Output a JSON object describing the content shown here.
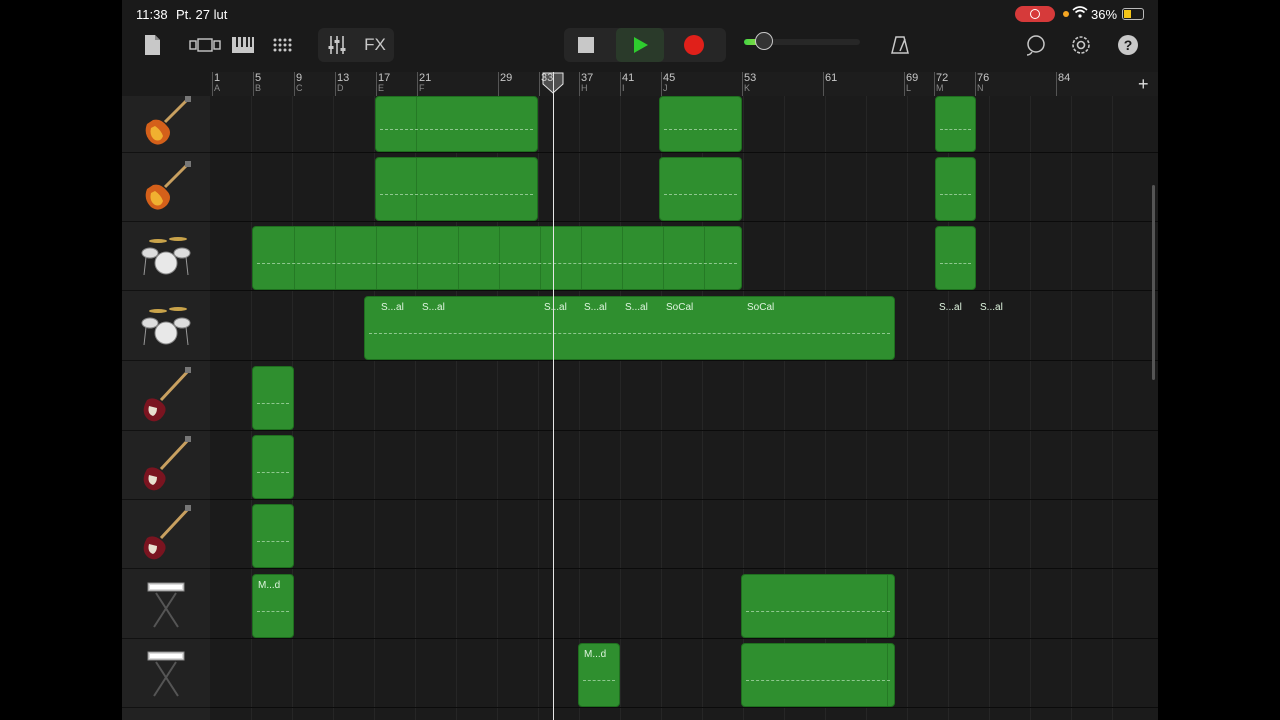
{
  "status": {
    "time": "11:38",
    "date": "Pt. 27 lut",
    "battery": "36%"
  },
  "toolbar": {
    "fx_label": "FX",
    "volume_level": 0.16,
    "icons": [
      "browser-icon",
      "view-toggle-icon",
      "keyboard-icon",
      "grid-icon",
      "mixer-icon",
      "fx",
      "stop-icon",
      "play-icon",
      "record-icon",
      "metronome-icon",
      "loop-icon",
      "settings-icon",
      "help-icon"
    ]
  },
  "ruler": {
    "bars": [
      {
        "num": "1",
        "sec": "A"
      },
      {
        "num": "5",
        "sec": "B"
      },
      {
        "num": "9",
        "sec": "C"
      },
      {
        "num": "13",
        "sec": "D"
      },
      {
        "num": "17",
        "sec": "E"
      },
      {
        "num": "21",
        "sec": "F"
      },
      {
        "num": "29",
        "sec": ""
      },
      {
        "num": "33",
        "sec": ""
      },
      {
        "num": "37",
        "sec": "H"
      },
      {
        "num": "41",
        "sec": "I"
      },
      {
        "num": "45",
        "sec": "J"
      },
      {
        "num": "53",
        "sec": "K"
      },
      {
        "num": "61",
        "sec": ""
      },
      {
        "num": "69",
        "sec": "L"
      },
      {
        "num": "72",
        "sec": "M"
      },
      {
        "num": "76",
        "sec": "N"
      },
      {
        "num": "84",
        "sec": ""
      }
    ]
  },
  "tracks": [
    {
      "instrument": "electric-guitar",
      "regions": []
    },
    {
      "instrument": "electric-guitar",
      "regions": []
    },
    {
      "instrument": "drum-kit",
      "regions": []
    },
    {
      "instrument": "drum-kit",
      "regions": [
        {
          "label": "S...al"
        },
        {
          "label": "S...al"
        },
        {
          "label": "S...al"
        },
        {
          "label": "S...al"
        },
        {
          "label": "S...al"
        },
        {
          "label": "SoCal"
        },
        {
          "label": "SoCal"
        },
        {
          "label": "S...al"
        },
        {
          "label": "S...al"
        }
      ]
    },
    {
      "instrument": "bass-guitar",
      "regions": []
    },
    {
      "instrument": "bass-guitar",
      "regions": []
    },
    {
      "instrument": "bass-guitar",
      "regions": []
    },
    {
      "instrument": "keyboard",
      "regions": [
        {
          "label": "M...d"
        }
      ]
    },
    {
      "instrument": "keyboard",
      "regions": [
        {
          "label": "M...d"
        }
      ]
    }
  ],
  "colors": {
    "region": "#2f8f2f",
    "record": "#e0201a",
    "play": "#2ecc2e"
  }
}
